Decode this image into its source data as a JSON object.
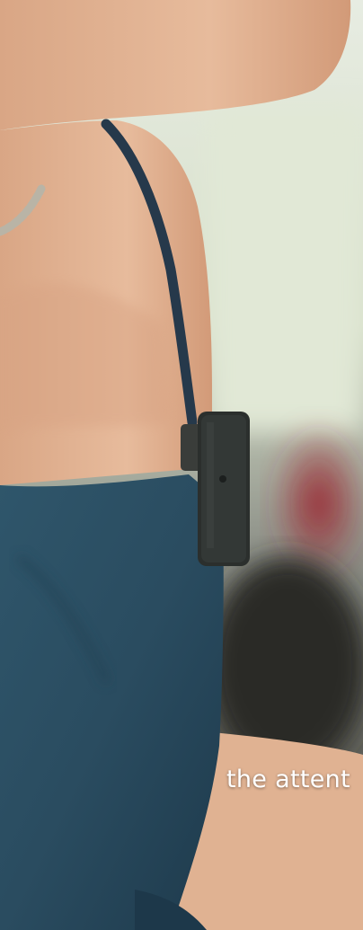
{
  "caption": {
    "text": "the attent"
  },
  "colors": {
    "background_blur": "#d7dccd",
    "skin": "#e2b394",
    "skin_shadow": "#c98f6f",
    "dress": "#2b4f63",
    "dress_dark": "#1d3a4b",
    "strap": "#24384a",
    "device": "#2a2e2c",
    "background_red": "#8a2a30",
    "caption_text": "#ffffff"
  },
  "objects": [
    "wireless-clip-microphone",
    "chain-necklace",
    "denim-blue-dress-strap"
  ]
}
